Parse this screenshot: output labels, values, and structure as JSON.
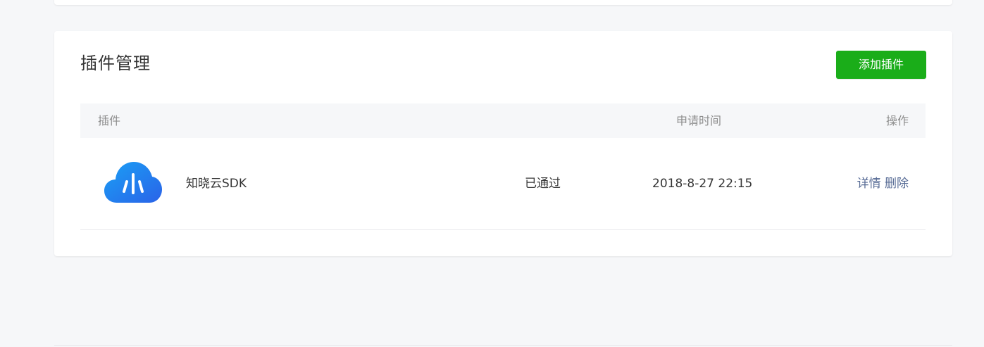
{
  "section": {
    "title": "插件管理",
    "add_button_label": "添加插件"
  },
  "table": {
    "headers": {
      "plugin": "插件",
      "apply_time": "申请时间",
      "action": "操作"
    },
    "rows": [
      {
        "name": "知晓云SDK",
        "status": "已通过",
        "apply_time": "2018-8-27 22:15",
        "actions": [
          "详情",
          "删除"
        ],
        "logo": {
          "icon": "xiao-cloud-icon",
          "glyph": "小",
          "gradient_start": "#1aa0f5",
          "gradient_end": "#2a63e8"
        }
      }
    ]
  },
  "colors": {
    "accent_green": "#1aad19",
    "link_blue": "#576b95",
    "page_bg": "#f6f7f9",
    "text_primary": "#353535",
    "text_secondary": "#8d8d8d"
  }
}
